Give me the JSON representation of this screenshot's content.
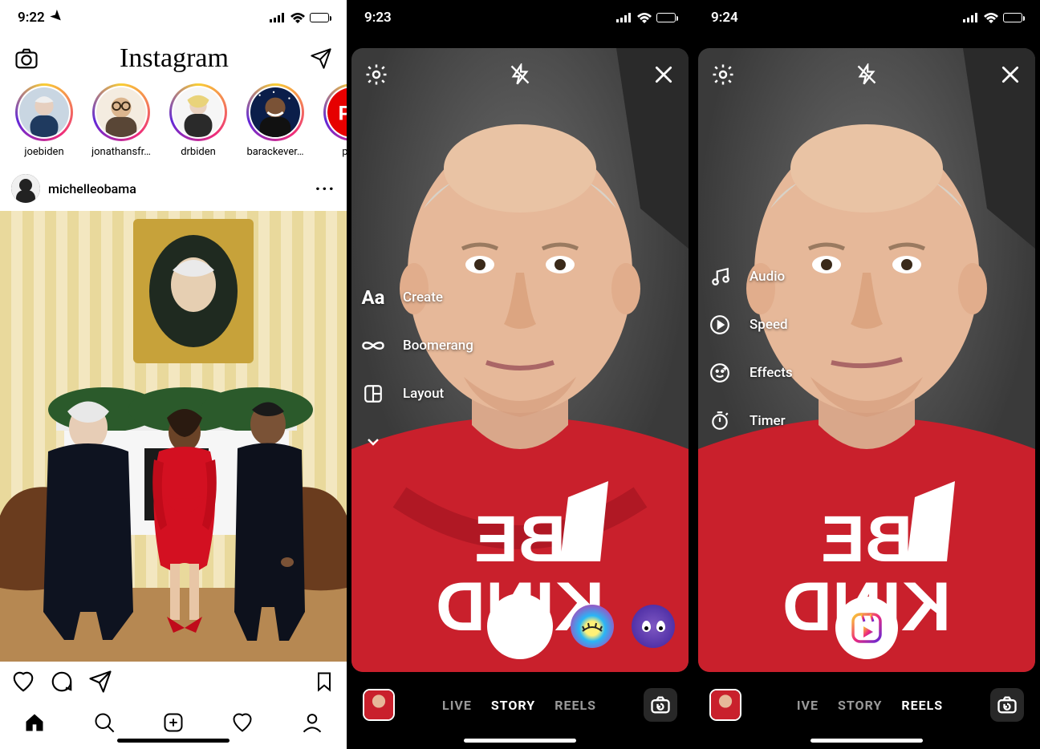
{
  "phone1": {
    "status": {
      "time": "9:22"
    },
    "header": {
      "logo": "Instagram"
    },
    "stories": [
      {
        "label": "joebiden"
      },
      {
        "label": "jonathansfr…"
      },
      {
        "label": "drbiden"
      },
      {
        "label": "barackever…"
      },
      {
        "label": "pcm"
      }
    ],
    "post": {
      "username": "michelleobama"
    }
  },
  "phone2": {
    "status": {
      "time": "9:23"
    },
    "sidemenu": [
      {
        "id": "create",
        "label": "Create"
      },
      {
        "id": "boomerang",
        "label": "Boomerang"
      },
      {
        "id": "layout",
        "label": "Layout"
      }
    ],
    "modes": {
      "live": "LIVE",
      "story": "STORY",
      "reels": "REELS",
      "active": "story"
    }
  },
  "phone3": {
    "status": {
      "time": "9:24"
    },
    "sidemenu": [
      {
        "id": "audio",
        "label": "Audio"
      },
      {
        "id": "speed",
        "label": "Speed"
      },
      {
        "id": "effects",
        "label": "Effects"
      },
      {
        "id": "timer",
        "label": "Timer"
      }
    ],
    "modes": {
      "live": "IVE",
      "story": "STORY",
      "reels": "REELS",
      "active": "reels"
    }
  }
}
